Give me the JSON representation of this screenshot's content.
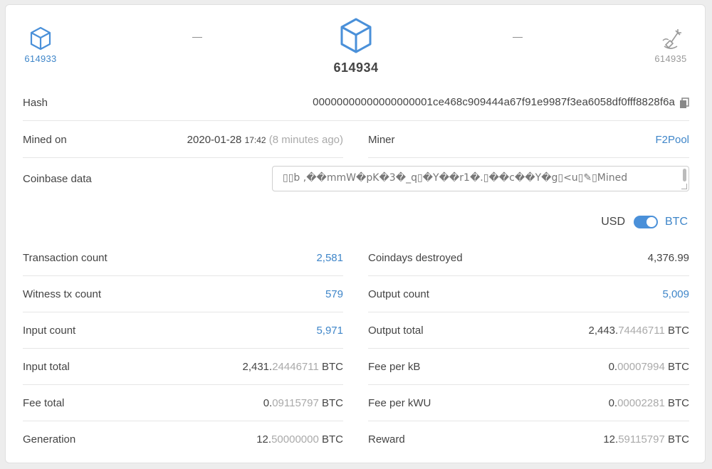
{
  "nav": {
    "prev_block": "614933",
    "prev_dash": "—",
    "current_block": "614934",
    "next_dash": "—",
    "next_block": "614935"
  },
  "hash": {
    "label": "Hash",
    "value": "00000000000000000001ce468c909444a67f91e9987f3ea6058df0fff8828f6a"
  },
  "mined_on": {
    "label": "Mined on",
    "date": "2020-01-28",
    "time": "17:42",
    "ago": "(8 minutes ago)"
  },
  "miner": {
    "label": "Miner",
    "value": "F2Pool"
  },
  "coinbase": {
    "label": "Coinbase data",
    "value": "▯▯b ,��mmW�pK�3�_q▯�Y��r1�.▯��c��Y�g▯<u▯✎▯Mined"
  },
  "currency_toggle": {
    "left": "USD",
    "right": "BTC",
    "selected": "BTC"
  },
  "left_stats": [
    {
      "label": "Transaction count",
      "main": "2,581",
      "dec": "",
      "unit": "",
      "link": true
    },
    {
      "label": "Witness tx count",
      "main": "579",
      "dec": "",
      "unit": "",
      "link": true
    },
    {
      "label": "Input count",
      "main": "5,971",
      "dec": "",
      "unit": "",
      "link": true
    },
    {
      "label": "Input total",
      "main": "2,431.",
      "dec": "24446711",
      "unit": "BTC",
      "link": false
    },
    {
      "label": "Fee total",
      "main": "0.",
      "dec": "09115797",
      "unit": "BTC",
      "link": false
    },
    {
      "label": "Generation",
      "main": "12.",
      "dec": "50000000",
      "unit": "BTC",
      "link": false
    }
  ],
  "right_stats": [
    {
      "label": "Coindays destroyed",
      "main": "4,376.99",
      "dec": "",
      "unit": "",
      "link": false
    },
    {
      "label": "Output count",
      "main": "5,009",
      "dec": "",
      "unit": "",
      "link": true
    },
    {
      "label": "Output total",
      "main": "2,443.",
      "dec": "74446711",
      "unit": "BTC",
      "link": false
    },
    {
      "label": "Fee per kB",
      "main": "0.",
      "dec": "00007994",
      "unit": "BTC",
      "link": false
    },
    {
      "label": "Fee per kWU",
      "main": "0.",
      "dec": "00002281",
      "unit": "BTC",
      "link": false
    },
    {
      "label": "Reward",
      "main": "12.",
      "dec": "59115797",
      "unit": "BTC",
      "link": false
    }
  ],
  "colors": {
    "link": "#3f86c9",
    "dim": "#aaaaaa",
    "toggle": "#4a90d9"
  }
}
